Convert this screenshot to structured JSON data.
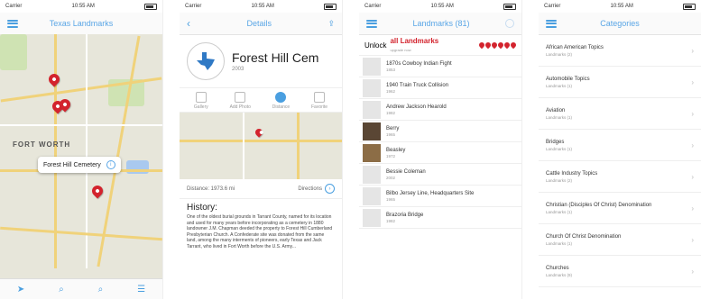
{
  "status": {
    "carrier": "Carrier",
    "time": "10:55 AM"
  },
  "screen1": {
    "title": "Texas Landmarks",
    "map_label": "FORT WORTH",
    "callout": "Forest Hill Cemetery"
  },
  "screen2": {
    "title": "Details",
    "name": "Forest Hill Cem",
    "year": "2003",
    "actions": [
      "Gallery",
      "Add Photo",
      "Distance",
      "Favorite"
    ],
    "distance": "Distance: 1973.6 mi",
    "directions": "Directions",
    "history_title": "History:",
    "history_text": "One of the oldest burial grounds in Tarrant County, named for its location and used for many years before incorporating as a cemetery in 1880 landowner J.M. Chapman deeded the property to Forest Hill Cumberland Presbyterian Church. A Confederate site was donated from the same land, among the many interments of pioneers, early Texas and Jack Tarrant, who lived in Fort Worth before the U.S. Army..."
  },
  "screen3": {
    "title": "Landmarks (81)",
    "unlock_prefix": "Unlock",
    "unlock_highlight": "all Landmarks",
    "unlock_small": "upgrade now",
    "items": [
      {
        "name": "1870s Cowboy Indian Fight",
        "year": "1853"
      },
      {
        "name": "1940 Train Truck Collision",
        "year": "1962"
      },
      {
        "name": "Andrew Jackson Hearold",
        "year": "1982"
      },
      {
        "name": "Berry",
        "year": "1965"
      },
      {
        "name": "Beasley",
        "year": "1972"
      },
      {
        "name": "Bessie Coleman",
        "year": "2002"
      },
      {
        "name": "Bilbo Jersey Line, Headquarters Site",
        "year": "1965"
      },
      {
        "name": "Brazoria Bridge",
        "year": "1982"
      }
    ]
  },
  "screen4": {
    "title": "Categories",
    "items": [
      {
        "name": "African American Topics",
        "count": "Landmarks (2)"
      },
      {
        "name": "Automobile Topics",
        "count": "Landmarks (1)"
      },
      {
        "name": "Aviation",
        "count": "Landmarks (1)"
      },
      {
        "name": "Bridges",
        "count": "Landmarks (1)"
      },
      {
        "name": "Cattle Industry Topics",
        "count": "Landmarks (2)"
      },
      {
        "name": "Christian (Disciples Of Christ) Denomination",
        "count": "Landmarks (1)"
      },
      {
        "name": "Church Of Christ Denomination",
        "count": "Landmarks (1)"
      },
      {
        "name": "Churches",
        "count": "Landmarks (9)"
      }
    ]
  },
  "colors": {
    "accent": "#4a9fe0",
    "pin": "#d3232d"
  }
}
